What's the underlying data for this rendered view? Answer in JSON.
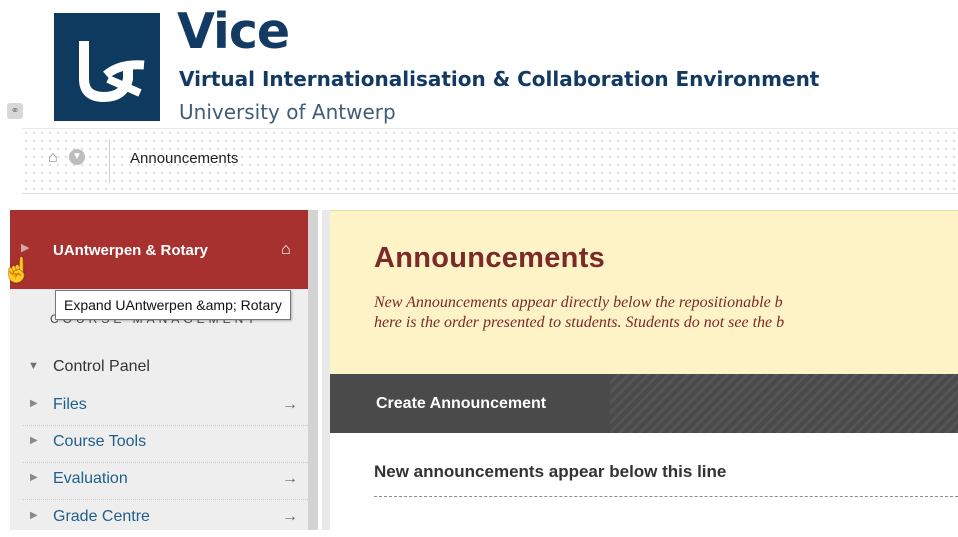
{
  "banner": {
    "title": "Vice",
    "subtitle": "Virtual Internationalisation & Collaboration Environment",
    "university": "University of Antwerp"
  },
  "breadcrumb": {
    "current": "Announcements"
  },
  "sidebar": {
    "course_title": "UAntwerpen & Rotary",
    "section_label": "COURSE MANAGEMENT",
    "tooltip": "Expand UAntwerpen &amp; Rotary",
    "control_panel": "Control Panel",
    "items": [
      {
        "label": "Files",
        "has_arrow": true
      },
      {
        "label": "Course Tools",
        "has_arrow": false
      },
      {
        "label": "Evaluation",
        "has_arrow": true
      },
      {
        "label": "Grade Centre",
        "has_arrow": true
      }
    ]
  },
  "main": {
    "page_title": "Announcements",
    "description_line1": "New Announcements appear directly below the repositionable b",
    "description_line2": "here is the order presented to students. Students do not see the b",
    "create_button": "Create Announcement",
    "line_note": "New announcements appear below this line"
  },
  "icons": {
    "home": "home-icon",
    "chevron": "chevron-down-icon",
    "course_home": "home-icon",
    "expand": "triangle-right-icon",
    "go": "arrow-right-icon"
  },
  "colors": {
    "brand_navy": "#0f3a5f",
    "course_header": "#a6312e",
    "page_header_bg": "#fdf3c7",
    "page_title": "#7a2a28",
    "action_bar": "#4a4a4a"
  }
}
